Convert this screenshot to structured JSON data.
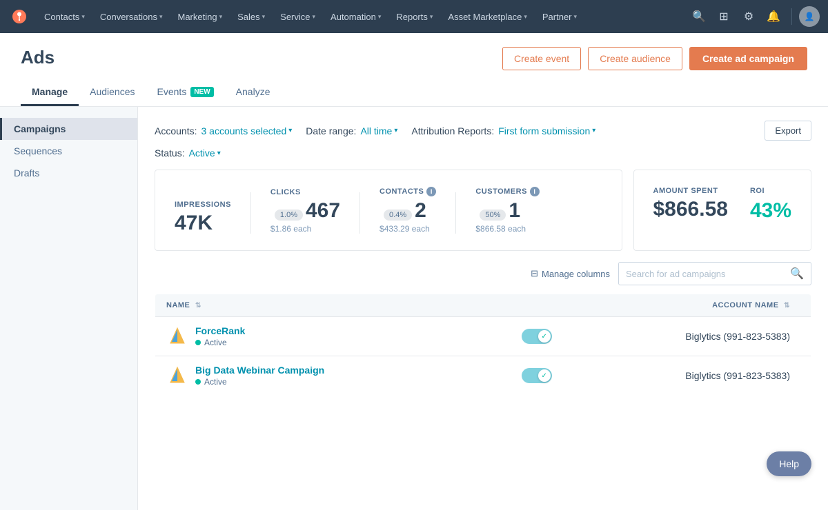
{
  "topnav": {
    "items": [
      {
        "label": "Contacts",
        "id": "contacts"
      },
      {
        "label": "Conversations",
        "id": "conversations"
      },
      {
        "label": "Marketing",
        "id": "marketing"
      },
      {
        "label": "Sales",
        "id": "sales"
      },
      {
        "label": "Service",
        "id": "service"
      },
      {
        "label": "Automation",
        "id": "automation"
      },
      {
        "label": "Reports",
        "id": "reports"
      },
      {
        "label": "Asset Marketplace",
        "id": "asset-marketplace"
      },
      {
        "label": "Partner",
        "id": "partner"
      }
    ]
  },
  "page": {
    "title": "Ads",
    "tabs": [
      {
        "label": "Manage",
        "id": "manage",
        "active": true,
        "badge": null
      },
      {
        "label": "Audiences",
        "id": "audiences",
        "active": false,
        "badge": null
      },
      {
        "label": "Events",
        "id": "events",
        "active": false,
        "badge": "NEW"
      },
      {
        "label": "Analyze",
        "id": "analyze",
        "active": false,
        "badge": null
      }
    ],
    "buttons": {
      "create_event": "Create event",
      "create_audience": "Create audience",
      "create_campaign": "Create ad campaign"
    }
  },
  "sidebar": {
    "items": [
      {
        "label": "Campaigns",
        "id": "campaigns",
        "active": true
      },
      {
        "label": "Sequences",
        "id": "sequences",
        "active": false
      },
      {
        "label": "Drafts",
        "id": "drafts",
        "active": false
      }
    ]
  },
  "filters": {
    "accounts_label": "Accounts:",
    "accounts_value": "3 accounts selected",
    "date_range_label": "Date range:",
    "date_range_value": "All time",
    "attribution_label": "Attribution Reports:",
    "attribution_value": "First form submission",
    "status_label": "Status:",
    "status_value": "Active",
    "export_label": "Export"
  },
  "stats": {
    "left": {
      "impressions": {
        "label": "IMPRESSIONS",
        "value": "47K"
      },
      "clicks": {
        "label": "CLICKS",
        "value": "467",
        "rate": "1.0%",
        "sub": "$1.86 each"
      },
      "contacts": {
        "label": "CONTACTS",
        "value": "2",
        "rate": "0.4%",
        "sub": "$433.29 each",
        "has_info": true
      },
      "customers": {
        "label": "CUSTOMERS",
        "value": "1",
        "rate": "50%",
        "sub": "$866.58 each",
        "has_info": true
      }
    },
    "right": {
      "amount_spent": {
        "label": "AMOUNT SPENT",
        "value": "$866.58"
      },
      "roi": {
        "label": "ROI",
        "value": "43%"
      }
    }
  },
  "table": {
    "manage_columns_label": "Manage columns",
    "search_placeholder": "Search for ad campaigns",
    "columns": [
      {
        "label": "NAME",
        "id": "name"
      },
      {
        "label": "ACCOUNT NAME",
        "id": "account-name"
      }
    ],
    "rows": [
      {
        "name": "ForceRank",
        "status": "Active",
        "account": "Biglytics (991-823-5383)",
        "toggle": true
      },
      {
        "name": "Big Data Webinar Campaign",
        "status": "Active",
        "account": "Biglytics (991-823-5383)",
        "toggle": true
      }
    ]
  },
  "help": {
    "label": "Help"
  }
}
